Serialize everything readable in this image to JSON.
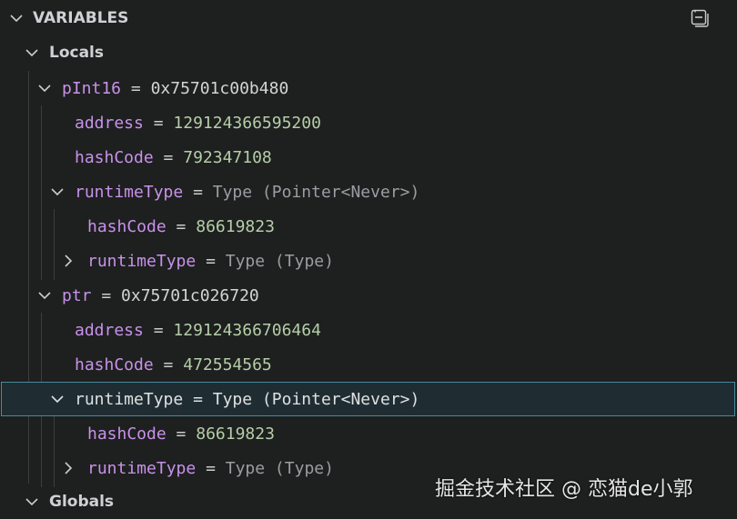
{
  "section_title": "VARIABLES",
  "locals_label": "Locals",
  "globals_label": "Globals",
  "equals": "=",
  "rows": {
    "pInt16": {
      "name": "pInt16",
      "value": "0x75701c00b480"
    },
    "pInt16_address": {
      "name": "address",
      "value": "129124366595200"
    },
    "pInt16_hashCode": {
      "name": "hashCode",
      "value": "792347108"
    },
    "pInt16_runtimeType": {
      "name": "runtimeType",
      "value": "Type (Pointer<Never>)"
    },
    "pInt16_rt_hashCode": {
      "name": "hashCode",
      "value": "86619823"
    },
    "pInt16_rt_runtimeType": {
      "name": "runtimeType",
      "value": "Type (Type)"
    },
    "ptr": {
      "name": "ptr",
      "value": "0x75701c026720"
    },
    "ptr_address": {
      "name": "address",
      "value": "129124366706464"
    },
    "ptr_hashCode": {
      "name": "hashCode",
      "value": "472554565"
    },
    "ptr_runtimeType": {
      "name": "runtimeType",
      "value": "Type (Pointer<Never>)"
    },
    "ptr_rt_hashCode": {
      "name": "hashCode",
      "value": "86619823"
    },
    "ptr_rt_runtimeType": {
      "name": "runtimeType",
      "value": "Type (Type)"
    }
  },
  "icons": {
    "collapse_all": "collapse-all-icon",
    "expanded": "chevron-down-icon",
    "collapsed": "chevron-right-icon"
  },
  "watermark": "掘金技术社区 @ 恋猫de小郭"
}
